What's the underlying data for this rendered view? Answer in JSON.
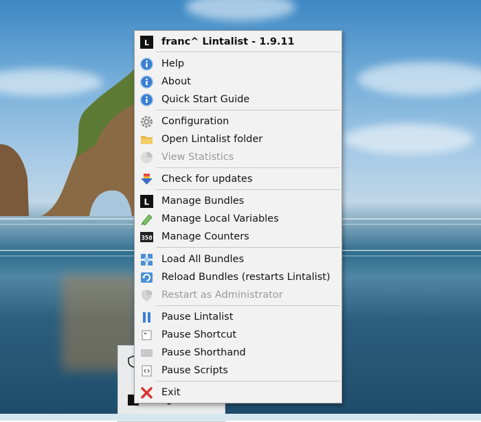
{
  "menu": {
    "title": "franc^ Lintalist - 1.9.11",
    "items": [
      {
        "label": "Help",
        "icon": "help-icon",
        "disabled": false
      },
      {
        "label": "About",
        "icon": "info-icon",
        "disabled": false
      },
      {
        "label": "Quick Start Guide",
        "icon": "guide-icon",
        "disabled": false
      },
      {
        "label": "Configuration",
        "icon": "gear-icon",
        "disabled": false
      },
      {
        "label": "Open Lintalist folder",
        "icon": "folder-icon",
        "disabled": false
      },
      {
        "label": "View Statistics",
        "icon": "statistics-icon",
        "disabled": true
      },
      {
        "label": "Check for updates",
        "icon": "update-icon",
        "disabled": false
      },
      {
        "label": "Manage Bundles",
        "icon": "bundle-icon",
        "disabled": false
      },
      {
        "label": "Manage Local Variables",
        "icon": "variable-icon",
        "disabled": false
      },
      {
        "label": "Manage Counters",
        "icon": "counter-icon",
        "disabled": false
      },
      {
        "label": "Load All Bundles",
        "icon": "load-bundles-icon",
        "disabled": false
      },
      {
        "label": "Reload Bundles (restarts Lintalist)",
        "icon": "reload-icon",
        "disabled": false
      },
      {
        "label": "Restart as Administrator",
        "icon": "shield-icon",
        "disabled": true
      },
      {
        "label": "Pause Lintalist",
        "icon": "pause-icon",
        "disabled": false
      },
      {
        "label": "Pause Shortcut",
        "icon": "keyboard-icon",
        "disabled": false
      },
      {
        "label": "Pause Shorthand",
        "icon": "shorthand-icon",
        "disabled": false
      },
      {
        "label": "Pause Scripts",
        "icon": "script-icon",
        "disabled": false
      },
      {
        "label": "Exit",
        "icon": "exit-icon",
        "disabled": false
      }
    ],
    "counter_icon_text": "350",
    "bundle_icon_text": "L"
  },
  "colors": {
    "menu_bg": "#f2f2f2",
    "disabled_text": "#9a9a9a",
    "exit_red": "#d9342b",
    "help_blue": "#2f7ed8"
  }
}
